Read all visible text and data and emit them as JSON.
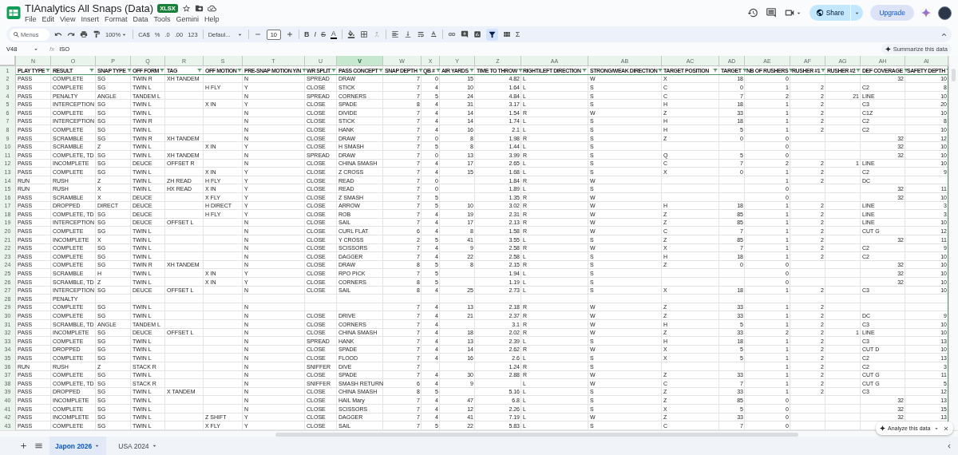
{
  "document": {
    "title": "TIAnalytics All Snaps (Data)",
    "badge": "XLSX"
  },
  "menu": [
    "File",
    "Edit",
    "View",
    "Insert",
    "Format",
    "Data",
    "Tools",
    "Gemini",
    "Help"
  ],
  "share_button": "Share",
  "upgrade_button": "Upgrade",
  "toolbar": {
    "search": {
      "placeholder": "Menus"
    },
    "zoom": "100%",
    "currency": "CA$",
    "percent": "%",
    "decimal_decrease": ".0",
    "decimal_increase": ".00",
    "number_format": "123",
    "font": "Defaul...",
    "font_size": "10",
    "bold": "B",
    "italic": "I",
    "strikethrough": "S",
    "text_color": "A",
    "functions": "Σ",
    "filter_active": true
  },
  "formula_bar": {
    "cell": "V48",
    "fx": "fx",
    "value": "ISO",
    "summarize_button": "Summarize this data"
  },
  "grid": {
    "header_row_number": "1",
    "columns": [
      {
        "letter": "N",
        "header": "PLAY TYPE",
        "selected": false
      },
      {
        "letter": "O",
        "header": "RESULT",
        "selected": false
      },
      {
        "letter": "P",
        "header": "SNAP TYPE",
        "selected": false
      },
      {
        "letter": "Q",
        "header": "OFF FORM",
        "selected": false
      },
      {
        "letter": "R",
        "header": "TAG",
        "selected": false
      },
      {
        "letter": "S",
        "header": "OFF MOTION",
        "selected": false
      },
      {
        "letter": "T",
        "header": "PRE-SNAP MOTION Y/N",
        "selected": false
      },
      {
        "letter": "U",
        "header": "WR SPLIT",
        "selected": false
      },
      {
        "letter": "V",
        "header": "PASS CONCEPT",
        "selected": true
      },
      {
        "letter": "W",
        "header": "SNAP DEPTH",
        "selected": false
      },
      {
        "letter": "X",
        "header": "QB #",
        "selected": false
      },
      {
        "letter": "Y",
        "header": "AIR YARDS",
        "selected": false
      },
      {
        "letter": "Z",
        "header": "TIME TO THROW",
        "selected": false
      },
      {
        "letter": "AA",
        "header": "RIGHT/LEFT DIRECTION",
        "selected": false
      },
      {
        "letter": "AB",
        "header": "STRONG/WEAK DIRECTION",
        "selected": false
      },
      {
        "letter": "AC",
        "header": "TARGET POSITION",
        "selected": false
      },
      {
        "letter": "AD",
        "header": "TARGET",
        "selected": false
      },
      {
        "letter": "AE",
        "header": "NB OF RUSHERS",
        "selected": false
      },
      {
        "letter": "AF",
        "header": "RUSHER #1",
        "selected": false
      },
      {
        "letter": "AG",
        "header": "RUSHER #2",
        "selected": false
      },
      {
        "letter": "AH",
        "header": "DEF COVERAGE",
        "selected": false
      },
      {
        "letter": "AI",
        "header": "SAFETY DEPTH",
        "selected": false
      }
    ],
    "rows": [
      {
        "number": "2",
        "cells": [
          "PASS",
          "COMPLETE",
          "SG",
          "TWIN R",
          "XH TANDEM",
          null,
          "N",
          "SPREAD",
          "DRAW",
          "7",
          "0",
          "15",
          "4.82",
          "L",
          "W",
          "X",
          "18",
          "0",
          null,
          null,
          "32",
          "10"
        ]
      },
      {
        "number": "3",
        "cells": [
          "PASS",
          "COMPLETE",
          "SG",
          "TWIN L",
          null,
          "H FLY",
          "Y",
          "CLOSE",
          "STICK",
          "7",
          "4",
          "10",
          "1.64",
          "L",
          "S",
          "C",
          "0",
          "1",
          "2",
          null,
          "C2",
          "8"
        ]
      },
      {
        "number": "4",
        "cells": [
          "PASS",
          "PENALTY",
          "ANGLE",
          "TANDEM L",
          null,
          null,
          "N",
          "SPREAD",
          "CORNERS",
          "7",
          "5",
          "24",
          "4.84",
          "L",
          "S",
          "C",
          "7",
          "2",
          "2",
          "21",
          "LINE",
          "10"
        ]
      },
      {
        "number": "5",
        "cells": [
          "PASS",
          "INTERCEPTION",
          "SG",
          "TWIN L",
          null,
          "X IN",
          "Y",
          "CLOSE",
          "SPADE",
          "8",
          "4",
          "31",
          "3.17",
          "L",
          "S",
          "H",
          "18",
          "1",
          "2",
          null,
          "C3",
          "20"
        ]
      },
      {
        "number": "6",
        "cells": [
          "PASS",
          "COMPLETE",
          "SG",
          "TWIN L",
          null,
          null,
          "N",
          "CLOSE",
          "DIVIDE",
          "7",
          "4",
          "14",
          "1.54",
          "R",
          "W",
          "Z",
          "33",
          "1",
          "2",
          null,
          "C1Z",
          "10"
        ]
      },
      {
        "number": "7",
        "cells": [
          "PASS",
          "INTERCEPTION",
          "SG",
          "TWIN R",
          null,
          null,
          "N",
          "CLOSE",
          "STICK",
          "7",
          "4",
          "14",
          "1.74",
          "L",
          "S",
          "H",
          "18",
          "1",
          "2",
          null,
          "C2",
          "8"
        ]
      },
      {
        "number": "8",
        "cells": [
          "PASS",
          "COMPLETE",
          "SG",
          "TWIN L",
          null,
          null,
          "N",
          "CLOSE",
          "HANK",
          "7",
          "4",
          "16",
          "2.1",
          "L",
          "S",
          "H",
          "5",
          "1",
          "2",
          null,
          "C2",
          "10"
        ]
      },
      {
        "number": "9",
        "cells": [
          "PASS",
          "SCRAMBLE",
          "SG",
          "TWIN R",
          "XH TANDEM",
          null,
          "N",
          "CLOSE",
          "DRAW",
          "7",
          "0",
          "8",
          "1.98",
          "R",
          "S",
          "Z",
          "0",
          "0",
          null,
          null,
          "32",
          "12"
        ]
      },
      {
        "number": "10",
        "cells": [
          "PASS",
          "SCRAMBLE",
          "Z",
          "TWIN L",
          null,
          "X IN",
          "Y",
          "CLOSE",
          "H SMASH",
          "7",
          "5",
          "8",
          "1.44",
          "L",
          "S",
          null,
          null,
          "0",
          null,
          null,
          "32",
          "10"
        ]
      },
      {
        "number": "11",
        "cells": [
          "PASS",
          "COMPLETE, TD",
          "SG",
          "TWIN L",
          "XH TANDEM",
          null,
          "N",
          "SPREAD",
          "DRAW",
          "7",
          "0",
          "13",
          "3.99",
          "R",
          "S",
          "Q",
          "5",
          "0",
          null,
          null,
          "32",
          "10"
        ]
      },
      {
        "number": "12",
        "cells": [
          "PASS",
          "INCOMPLETE",
          "SG",
          "DEUCE",
          "OFFSET R",
          null,
          "N",
          "CLOSE",
          "CHINA SMASH",
          "7",
          "4",
          "17",
          "2.65",
          "L",
          "S",
          "C",
          "7",
          "2",
          "2",
          "1",
          "LINE",
          "10"
        ]
      },
      {
        "number": "13",
        "cells": [
          "PASS",
          "COMPLETE",
          "SG",
          "TWIN L",
          null,
          "X IN",
          "Y",
          "CLOSE",
          "Z CROSS",
          "7",
          "4",
          "15",
          "1.68",
          "L",
          "S",
          "X",
          "0",
          "1",
          "2",
          null,
          "C2",
          "9"
        ]
      },
      {
        "number": "14",
        "cells": [
          "RUN",
          "RUSH",
          "Z",
          "TWIN L",
          "ZH READ",
          "H FLY",
          "Y",
          "CLOSE",
          "READ",
          "7",
          "0",
          null,
          "1.84",
          "R",
          "W",
          null,
          null,
          "1",
          "2",
          null,
          "DC",
          null
        ]
      },
      {
        "number": "15",
        "cells": [
          "RUN",
          "RUSH",
          "X",
          "TWIN L",
          "HX READ",
          "X IN",
          "Y",
          "CLOSE",
          "READ",
          "7",
          "0",
          null,
          "1.89",
          "L",
          "S",
          null,
          null,
          "0",
          null,
          null,
          "32",
          "11"
        ]
      },
      {
        "number": "16",
        "cells": [
          "PASS",
          "SCRAMBLE",
          "X",
          "DEUCE",
          null,
          "X FLY",
          "Y",
          "CLOSE",
          "Z SMASH",
          "7",
          "5",
          null,
          "1.35",
          "R",
          "W",
          null,
          null,
          "0",
          null,
          null,
          "32",
          "10"
        ]
      },
      {
        "number": "17",
        "cells": [
          "PASS",
          "DROPPED",
          "DIRECT",
          "DEUCE",
          null,
          "H DIRECT",
          "Y",
          "CLOSE",
          "ARROW",
          "7",
          "5",
          "10",
          "3.02",
          "R",
          "W",
          "H",
          "18",
          "1",
          "2",
          null,
          "LINE",
          "3"
        ]
      },
      {
        "number": "18",
        "cells": [
          "PASS",
          "COMPLETE, TD",
          "SG",
          "DEUCE",
          null,
          "H FLY",
          "Y",
          "CLOSE",
          "ROB",
          "7",
          "4",
          "19",
          "2.31",
          "R",
          "W",
          "Z",
          "85",
          "1",
          "2",
          null,
          "LINE",
          "3"
        ]
      },
      {
        "number": "19",
        "cells": [
          "PASS",
          "INTERCEPTION",
          "SG",
          "DEUCE",
          "OFFSET L",
          null,
          "N",
          "CLOSE",
          "SAIL",
          "7",
          "4",
          "17",
          "2.13",
          "R",
          "W",
          "Z",
          "85",
          "1",
          "2",
          null,
          "LINE",
          "10"
        ]
      },
      {
        "number": "20",
        "cells": [
          "PASS",
          "COMPLETE",
          "SG",
          "TWIN L",
          null,
          null,
          "N",
          "CLOSE",
          "CURL FLAT",
          "6",
          "4",
          "8",
          "1.58",
          "R",
          "W",
          "C",
          "7",
          "1",
          "2",
          null,
          "CUT G",
          "12"
        ]
      },
      {
        "number": "21",
        "cells": [
          "PASS",
          "INCOMPLETE",
          "X",
          "TWIN L",
          null,
          null,
          "N",
          "CLOSE",
          "Y CROSS",
          "2",
          "5",
          "41",
          "3.55",
          "L",
          "S",
          "Z",
          "85",
          "1",
          "2",
          null,
          "32",
          "11"
        ]
      },
      {
        "number": "22",
        "cells": [
          "PASS",
          "COMPLETE",
          "SG",
          "TWIN L",
          null,
          null,
          "N",
          "CLOSE",
          "SCISSORS",
          "7",
          "4",
          "9",
          "2.58",
          "R",
          "W",
          "X",
          "7",
          "1",
          "2",
          null,
          "C2",
          "9"
        ]
      },
      {
        "number": "23",
        "cells": [
          "PASS",
          "COMPLETE",
          "SG",
          "TWIN L",
          null,
          null,
          "N",
          "CLOSE",
          "DAGGER",
          "7",
          "4",
          "22",
          "2.58",
          "L",
          "S",
          "H",
          "18",
          "1",
          "2",
          null,
          "C2",
          "10"
        ]
      },
      {
        "number": "24",
        "cells": [
          "PASS",
          "COMPLETE",
          "SG",
          "TWIN R",
          "XH TANDEM",
          null,
          "N",
          "CLOSE",
          "DRAW",
          "8",
          "5",
          "8",
          "2.15",
          "R",
          "S",
          "Z",
          "0",
          "0",
          null,
          null,
          "32",
          "10"
        ]
      },
      {
        "number": "25",
        "cells": [
          "PASS",
          "SCRAMBLE",
          "H",
          "TWIN L",
          null,
          "X IN",
          "Y",
          "CLOSE",
          "RPO PICK",
          "7",
          "5",
          null,
          "1.94",
          "L",
          "S",
          null,
          null,
          "0",
          null,
          null,
          "32",
          "10"
        ]
      },
      {
        "number": "26",
        "cells": [
          "PASS",
          "SCRAMBLE, TD",
          "Z",
          "TWIN L",
          null,
          "X IN",
          "Y",
          "CLOSE",
          "CORNERS",
          "8",
          "5",
          null,
          "1.19",
          "L",
          "S",
          null,
          null,
          "0",
          null,
          null,
          "32",
          "10"
        ]
      },
      {
        "number": "27",
        "cells": [
          "PASS",
          "INTERCEPTION",
          "SG",
          "DEUCE",
          "OFFSET L",
          null,
          "N",
          "CLOSE",
          "SAIL",
          "8",
          "4",
          "25",
          "2.73",
          "L",
          "S",
          "X",
          "18",
          "1",
          "2",
          null,
          "C3",
          "10"
        ]
      },
      {
        "number": "28",
        "cells": [
          "PASS",
          "PENALTY"
        ]
      },
      {
        "number": "29",
        "cells": [
          "PASS",
          "COMPLETE",
          "SG",
          "TWIN L",
          null,
          null,
          "N",
          null,
          null,
          "7",
          "4",
          "13",
          "2.18",
          "R",
          "W",
          "Z",
          "33",
          "1",
          "2"
        ]
      },
      {
        "number": "30",
        "cells": [
          "PASS",
          "COMPLETE",
          "SG",
          "TWIN L",
          null,
          null,
          "N",
          "CLOSE",
          "DRIVE",
          "7",
          "4",
          "21",
          "2.37",
          "R",
          "W",
          "Z",
          "33",
          "1",
          "2",
          null,
          "DC",
          "9"
        ]
      },
      {
        "number": "31",
        "cells": [
          "PASS",
          "SCRAMBLE, TD",
          "ANGLE",
          "TANDEM L",
          null,
          null,
          "N",
          "CLOSE",
          "CORNERS",
          "7",
          "4",
          null,
          "3.1",
          "R",
          "W",
          "H",
          "5",
          "1",
          "2",
          null,
          "C3",
          "10"
        ]
      },
      {
        "number": "32",
        "cells": [
          "PASS",
          "INCOMPLETE",
          "SG",
          "DEUCE",
          "OFFSET L",
          null,
          "N",
          "CLOSE",
          "CHINA SMASH",
          "7",
          "4",
          "18",
          "2.02",
          "R",
          "W",
          "Z",
          "33",
          "2",
          "2",
          "1",
          "LINE",
          "10"
        ]
      },
      {
        "number": "33",
        "cells": [
          "PASS",
          "COMPLETE",
          "SG",
          "TWIN L",
          null,
          null,
          "N",
          "SPREAD",
          "HANK",
          "7",
          "4",
          "13",
          "2.39",
          "L",
          "S",
          "H",
          "18",
          "1",
          "2",
          null,
          "C3",
          "13"
        ]
      },
      {
        "number": "34",
        "cells": [
          "PASS",
          "DROPPED",
          "SG",
          "TWIN L",
          null,
          null,
          "N",
          "CLOSE",
          "SPADE",
          "7",
          "4",
          "14",
          "2.62",
          "R",
          "W",
          "X",
          "5",
          "1",
          "2",
          null,
          "CUT D",
          "10"
        ]
      },
      {
        "number": "35",
        "cells": [
          "PASS",
          "COMPLETE",
          "SG",
          "TWIN L",
          null,
          null,
          "N",
          "CLOSE",
          "FLOOD",
          "7",
          "4",
          "16",
          "2.6",
          "L",
          "S",
          "X",
          "5",
          "1",
          "2",
          null,
          "C2",
          "13"
        ]
      },
      {
        "number": "36",
        "cells": [
          "RUN",
          "RUSH",
          "Z",
          "STACK R",
          null,
          null,
          "N",
          "SNIFFER",
          "DIVE",
          "7",
          null,
          null,
          "1.24",
          "R",
          "S",
          null,
          null,
          "1",
          "2",
          null,
          "C2",
          "3"
        ]
      },
      {
        "number": "37",
        "cells": [
          "PASS",
          "COMPLETE",
          "SG",
          "TWIN L",
          null,
          null,
          "N",
          "CLOSE",
          "SPADE",
          "7",
          "4",
          "30",
          "2.88",
          "R",
          "W",
          "Z",
          "33",
          "1",
          "2",
          null,
          "CUT G",
          "11"
        ]
      },
      {
        "number": "38",
        "cells": [
          "PASS",
          "COMPLETE, TD",
          "SG",
          "STACK R",
          null,
          null,
          "N",
          "SNIFFER",
          "SMASH RETURN",
          "6",
          "4",
          "9",
          null,
          "L",
          "W",
          "C",
          "7",
          "1",
          "2",
          null,
          "CUT G",
          "5"
        ]
      },
      {
        "number": "39",
        "cells": [
          "PASS",
          "DROPPED",
          "SG",
          "TWIN L",
          "X TANDEM",
          null,
          "N",
          "CLOSE",
          "CHINA SMASH",
          "8",
          "5",
          null,
          "5.16",
          "L",
          "S",
          "Z",
          "33",
          "1",
          "2",
          null,
          "C3",
          "12"
        ]
      },
      {
        "number": "40",
        "cells": [
          "PASS",
          "INCOMPLETE",
          "SG",
          "TWIN L",
          null,
          null,
          "N",
          "CLOSE",
          "HAIL Mary",
          "7",
          "4",
          "47",
          "6.8",
          "L",
          "S",
          "Z",
          "85",
          "0",
          null,
          null,
          "32",
          "13"
        ]
      },
      {
        "number": "41",
        "cells": [
          "PASS",
          "COMPLETE",
          "SG",
          "TWIN L",
          null,
          null,
          "N",
          "CLOSE",
          "SCISSORS",
          "7",
          "4",
          "12",
          "2.26",
          "L",
          "S",
          "X",
          "5",
          "0",
          null,
          null,
          "32",
          "15"
        ]
      },
      {
        "number": "42",
        "cells": [
          "PASS",
          "INCOMPLETE",
          "SG",
          "TWIN L",
          null,
          "Z SHIFT",
          "Y",
          "CLOSE",
          "DAGGER",
          "7",
          "4",
          "41",
          "7.19",
          "L",
          "W",
          "Z",
          "33",
          "0",
          null,
          null,
          "32",
          "13"
        ]
      },
      {
        "number": "43",
        "cells": [
          "PASS",
          "COMPLETE",
          "SG",
          "TWIN L",
          null,
          "X FLY",
          "Y",
          "CLOSE",
          "SAIL",
          "7",
          "5",
          "22",
          "5.83",
          "L",
          "S",
          "C",
          "7",
          "0"
        ]
      }
    ]
  },
  "sheets": [
    {
      "name": "Japon 2026",
      "selected": true
    },
    {
      "name": "USA 2024",
      "selected": false
    }
  ],
  "analyze_popup": {
    "label": "Analyze this data"
  }
}
